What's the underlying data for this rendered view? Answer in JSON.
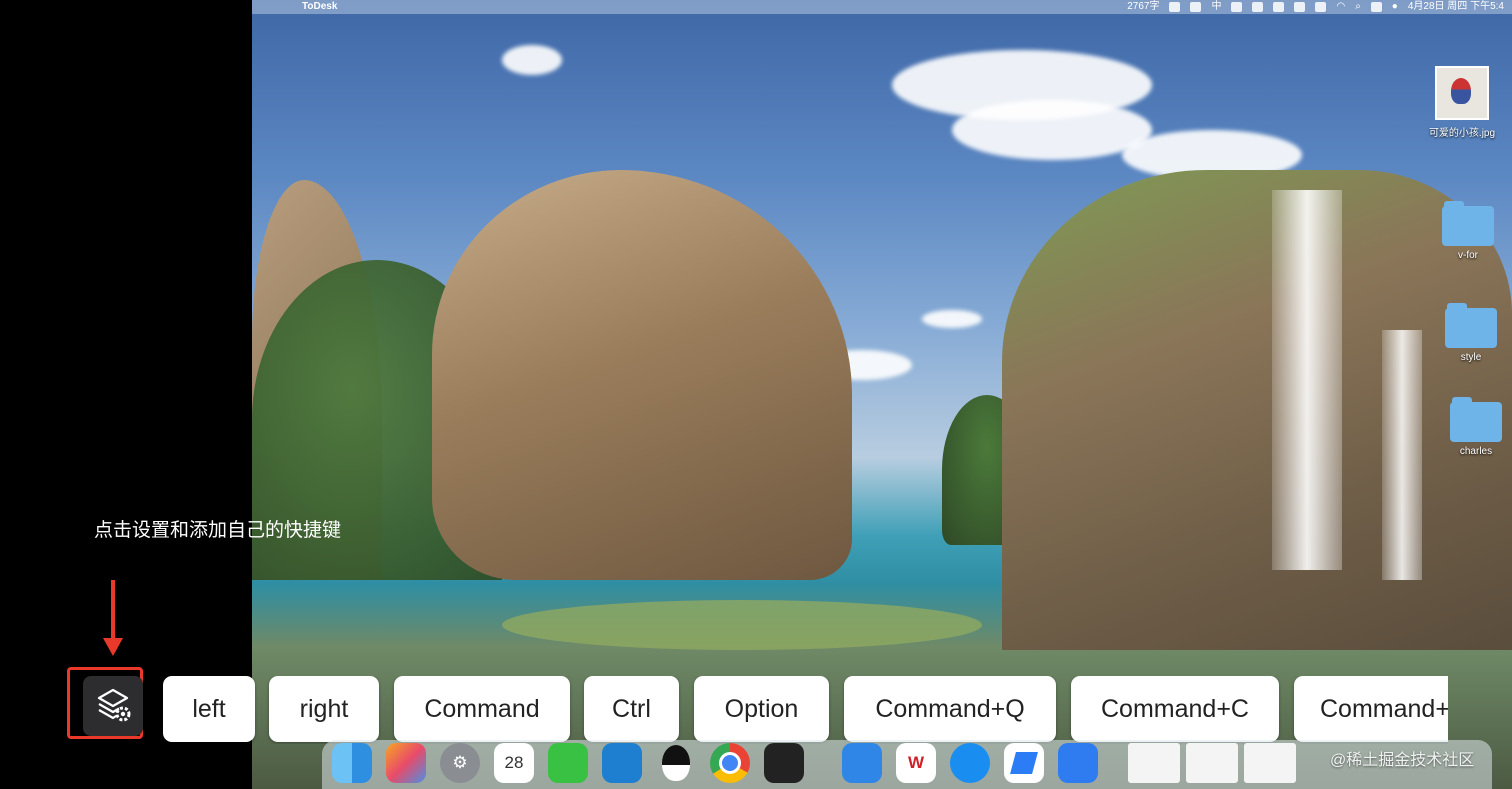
{
  "menubar": {
    "app_name": "ToDesk",
    "word_count": "2767字",
    "input_method": "中",
    "datetime": "4月28日 周四 下午5:4"
  },
  "desktop_icons": [
    {
      "label": "可爱的小孩.jpg",
      "type": "image"
    },
    {
      "label": "v-for",
      "type": "folder"
    },
    {
      "label": "style",
      "type": "folder"
    },
    {
      "label": "charles",
      "type": "folder"
    }
  ],
  "hint": {
    "text": "点击设置和添加自己的快捷键"
  },
  "settings": {
    "icon": "settings-gear-icon"
  },
  "shortcuts": [
    {
      "label": "left"
    },
    {
      "label": "right"
    },
    {
      "label": "Command"
    },
    {
      "label": "Ctrl"
    },
    {
      "label": "Option"
    },
    {
      "label": "Command+Q"
    },
    {
      "label": "Command+C"
    },
    {
      "label": "Command+"
    }
  ],
  "dock": {
    "calendar_day": "28",
    "apps": [
      "finder-icon",
      "launchpad-icon",
      "system-preferences-icon",
      "calendar-icon",
      "wechat-icon",
      "vscode-icon",
      "qq-icon",
      "chrome-icon",
      "terminal-icon",
      "notes-icon",
      "wps-icon",
      "safari-icon",
      "todesk-icon",
      "lark-icon"
    ]
  },
  "watermark": {
    "text": "@稀土掘金技术社区"
  },
  "colors": {
    "highlight": "#e8392b",
    "key_bg": "#ffffff",
    "settings_bg": "#2d2d2f"
  }
}
